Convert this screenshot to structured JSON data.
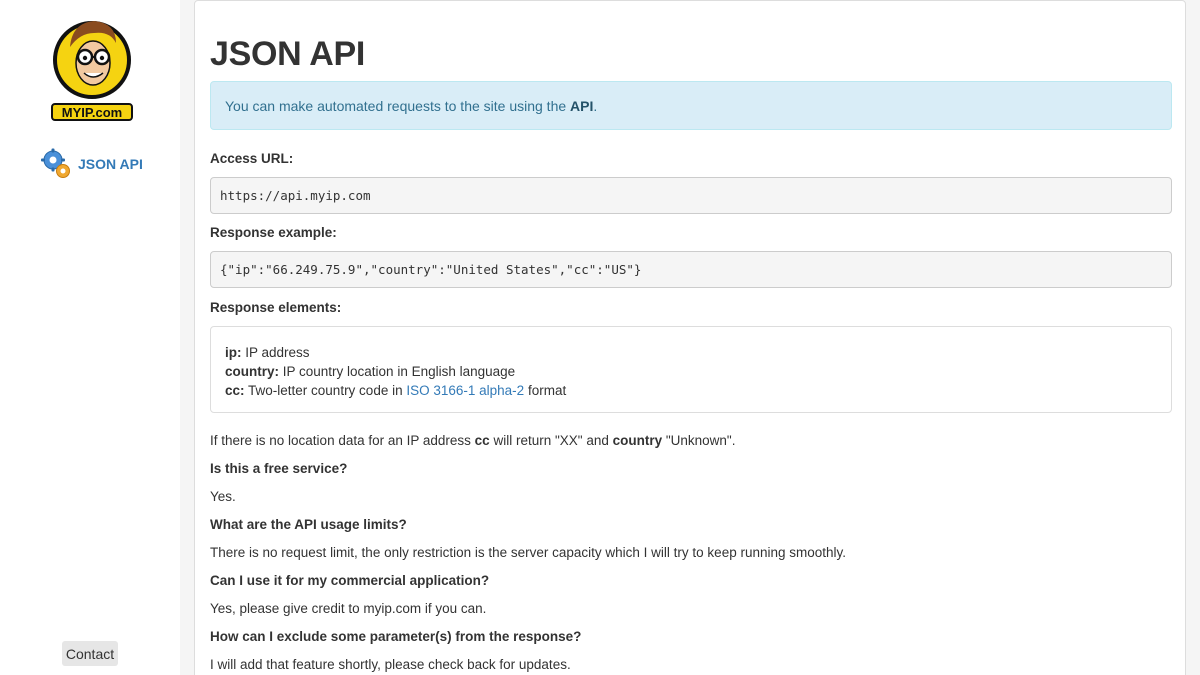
{
  "sidebar": {
    "logo_text": "MYIP.com",
    "nav_item_label": "JSON API",
    "contact_label": "Contact"
  },
  "main": {
    "title": "JSON API",
    "info": {
      "prefix": "You can make automated requests to the site using the ",
      "link": "API",
      "suffix": "."
    },
    "access_url_label": "Access URL:",
    "access_url": "https://api.myip.com",
    "response_example_label": "Response example:",
    "response_example": "{\"ip\":\"66.249.75.9\",\"country\":\"United States\",\"cc\":\"US\"}",
    "response_elements_label": "Response elements:",
    "elements": {
      "ip_key": "ip:",
      "ip_desc": " IP address",
      "country_key": "country:",
      "country_desc": " IP country location in English language",
      "cc_key": "cc:",
      "cc_desc_prefix": " Two-letter country code in ",
      "cc_link": "ISO 3166-1 alpha-2",
      "cc_desc_suffix": " format"
    },
    "note": {
      "p1": "If there is no location data for an IP address ",
      "b1": "cc",
      "p2": " will return \"XX\" and ",
      "b2": "country",
      "p3": " \"Unknown\"."
    },
    "faq": [
      {
        "q": "Is this a free service?",
        "a": "Yes."
      },
      {
        "q": "What are the API usage limits?",
        "a": "There is no request limit, the only restriction is the server capacity which I will try to keep running smoothly."
      },
      {
        "q": "Can I use it for my commercial application?",
        "a": "Yes, please give credit to myip.com if you can."
      },
      {
        "q": "How can I exclude some parameter(s) from the response?",
        "a": "I will add that feature shortly, please check back for updates."
      }
    ]
  },
  "colors": {
    "link": "#337ab7",
    "info_bg": "#d9edf7",
    "info_text": "#31708f",
    "logo_yellow": "#f5d311"
  }
}
